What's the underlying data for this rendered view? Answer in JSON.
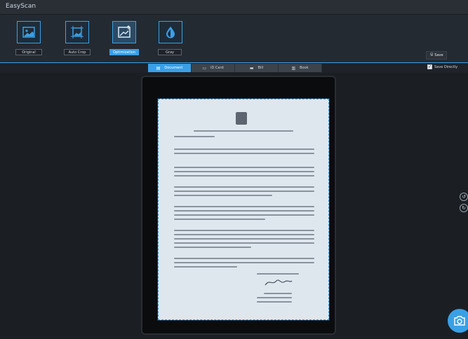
{
  "window": {
    "title": "EasyScan"
  },
  "modes": [
    {
      "label": "Original",
      "icon": "image-icon",
      "active": false
    },
    {
      "label": "Auto Crop",
      "icon": "crop-image-icon",
      "active": false
    },
    {
      "label": "Optimization",
      "icon": "enhance-image-icon",
      "active": true
    },
    {
      "label": "Gray",
      "icon": "drop-icon",
      "active": false
    }
  ],
  "save": {
    "label": "Save",
    "icon": "save-icon"
  },
  "save_directly": {
    "label": "Save Directly",
    "checked": true
  },
  "tabs": [
    {
      "label": "Document",
      "icon": "document-icon",
      "active": true
    },
    {
      "label": "ID Card",
      "icon": "id-card-icon",
      "active": false
    },
    {
      "label": "Bill",
      "icon": "bill-icon",
      "active": false
    },
    {
      "label": "Book",
      "icon": "book-icon",
      "active": false
    }
  ],
  "side_controls": [
    "rotate-left-icon",
    "rotate-right-icon"
  ],
  "capture": {
    "icon": "camera-icon"
  },
  "colors": {
    "accent": "#3aa0e6",
    "background": "#1f2329",
    "toolbar": "#242a31"
  }
}
